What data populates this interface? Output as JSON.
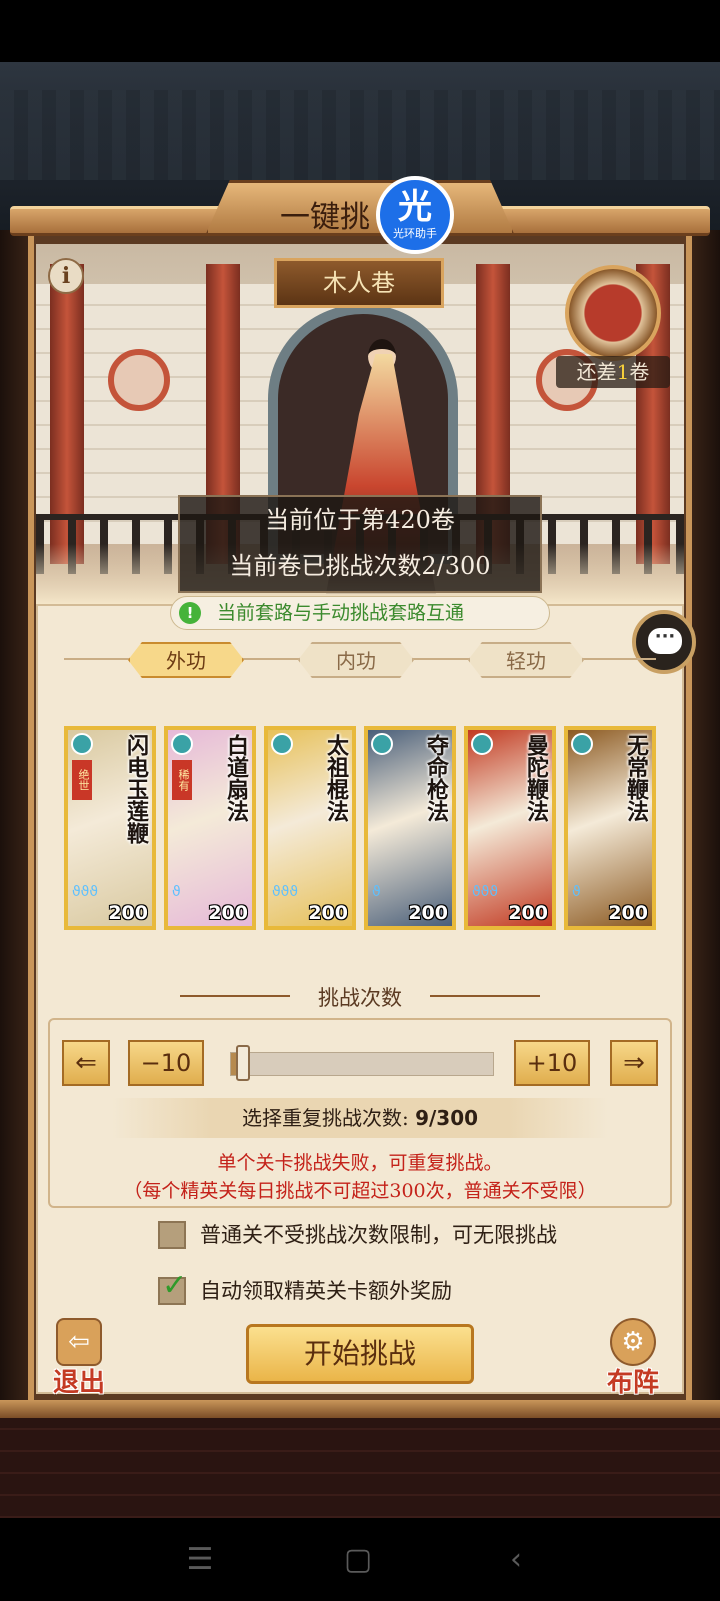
{
  "header": {
    "title": "一键挑",
    "badge_main": "光",
    "badge_sub": "光环助手"
  },
  "stage": {
    "info_glyph": "i",
    "name": "木人巷",
    "scroll_remain_prefix": "还差",
    "scroll_remain_count": "1",
    "scroll_remain_suffix": "卷",
    "position_line": "当前位于第420卷",
    "attempts_line": "当前卷已挑战次数2/300"
  },
  "interop_notice": {
    "icon": "!",
    "text": "当前套路与手动挑战套路互通"
  },
  "chat": {
    "icon": "chat-bubble-icon",
    "glyph": "···"
  },
  "tabs": [
    {
      "label": "外功",
      "active": true
    },
    {
      "label": "内功",
      "active": false
    },
    {
      "label": "轻功",
      "active": false
    }
  ],
  "cards": [
    {
      "name": "闪电玉莲鞭",
      "level": "200",
      "tag": "绝世",
      "drops": "ϑϑϑ",
      "palette": "#d9c9a0"
    },
    {
      "name": "白道扇法",
      "level": "200",
      "tag": "稀有",
      "drops": "ϑ",
      "palette": "#e6b9d8"
    },
    {
      "name": "太祖棍法",
      "level": "200",
      "tag": "",
      "drops": "ϑϑϑ",
      "palette": "#e7c15a"
    },
    {
      "name": "夺命枪法",
      "level": "200",
      "tag": "",
      "drops": "ϑ",
      "palette": "#4a5f7a"
    },
    {
      "name": "曼陀鞭法",
      "level": "200",
      "tag": "",
      "drops": "ϑϑϑ",
      "palette": "#c23a22"
    },
    {
      "name": "无常鞭法",
      "level": "200",
      "tag": "",
      "drops": "ϑ",
      "palette": "#8c5a22"
    }
  ],
  "challenge": {
    "section_title": "挑战次数",
    "minus_label": "−10",
    "plus_label": "+10",
    "left_arrow": "⇐",
    "right_arrow": "⇒",
    "slider_fraction": 0.03,
    "repeat_prefix": "选择重复挑战次数: ",
    "repeat_value": "9/300",
    "warning_1": "单个关卡挑战失败，可重复挑战。",
    "warning_2": "（每个精英关每日挑战不可超过300次，普通关不受限）"
  },
  "options": [
    {
      "label": "普通关不受挑战次数限制，可无限挑战",
      "checked": false
    },
    {
      "label": "自动领取精英关卡额外奖励",
      "checked": true
    }
  ],
  "actions": {
    "start": "开始挑战",
    "exit": "退出",
    "formation": "布阵"
  },
  "nav": {
    "menu": "☰",
    "home": "▢",
    "back": "‹"
  }
}
